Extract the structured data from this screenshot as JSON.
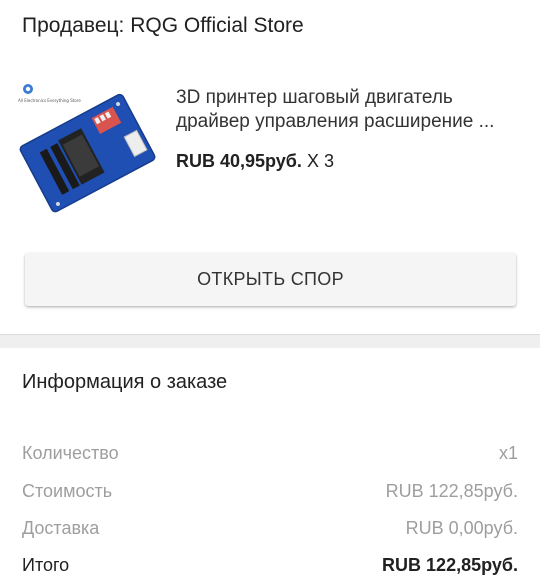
{
  "seller": {
    "label": "Продавец: RQG Official Store"
  },
  "product": {
    "image_label": "All Electronics Everything Store",
    "title_line1": "3D принтер шаговый двигатель",
    "title_line2": "драйвер управления расширение ...",
    "price": "RUB 40,95руб.",
    "quantity": "X 3"
  },
  "dispute_button": {
    "label": "ОТКРЫТЬ СПОР"
  },
  "order_info": {
    "title": "Информация о заказе",
    "rows": [
      {
        "label": "Количество",
        "value": "x1"
      },
      {
        "label": "Стоимость",
        "value": "RUB 122,85руб."
      },
      {
        "label": "Доставка",
        "value": "RUB 0,00руб."
      }
    ],
    "total": {
      "label": "Итого",
      "value": "RUB 122,85руб."
    }
  }
}
